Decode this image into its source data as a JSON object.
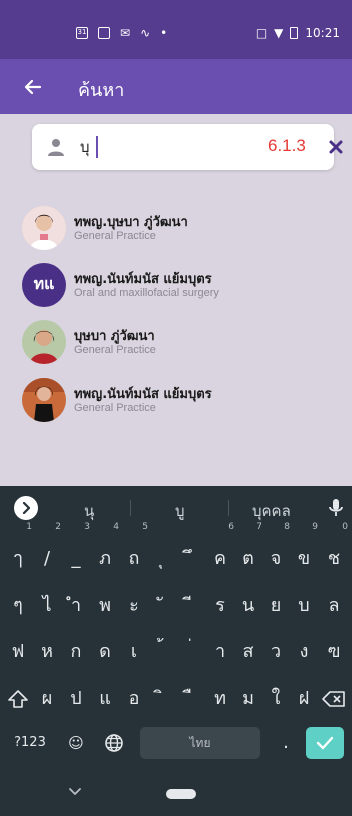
{
  "status_bar": {
    "time": "10:21",
    "icons": [
      "calendar-31-icon",
      "image-icon",
      "gmail-icon",
      "squiggle-icon",
      "dot-icon",
      "vibrate-icon",
      "wifi-icon",
      "battery-icon"
    ],
    "calendar_day": "31"
  },
  "app_bar": {
    "title": "ค้นหา",
    "back_icon": "arrow-left-icon"
  },
  "search": {
    "value": "บุ",
    "version": "6.1.3",
    "clear_icon": "close-icon",
    "person_icon": "person-icon"
  },
  "results": [
    {
      "name": "ทพญ.บุษบา ภู่วัฒนา",
      "specialty": "General Practice",
      "avatar": "photo"
    },
    {
      "name": "ทพญ.นันท์มนัส แย้มบุตร",
      "specialty": "Oral and maxillofacial surgery",
      "avatar": "initials",
      "initials": "ทแ"
    },
    {
      "name": "บุษบา ภู่วัฒนา",
      "specialty": "General Practice",
      "avatar": "photo"
    },
    {
      "name": "ทพญ.นันท์มนัส แย้มบุตร",
      "specialty": "General Practice",
      "avatar": "photo"
    }
  ],
  "keyboard": {
    "suggestions": [
      "นุ",
      "บู",
      "บุคคล"
    ],
    "row1": [
      {
        "k": "ๅ",
        "h": "1"
      },
      {
        "k": "/",
        "h": "2"
      },
      {
        "k": "_",
        "h": "3"
      },
      {
        "k": "ภ",
        "h": "4"
      },
      {
        "k": "ถ",
        "h": "5"
      },
      {
        "k": "ุ",
        "h": ""
      },
      {
        "k": "ึ",
        "h": ""
      },
      {
        "k": "ค",
        "h": "6"
      },
      {
        "k": "ต",
        "h": "7"
      },
      {
        "k": "จ",
        "h": "8"
      },
      {
        "k": "ข",
        "h": "9"
      },
      {
        "k": "ช",
        "h": "0"
      }
    ],
    "row2": [
      "ๆ",
      "ไ",
      "ำ",
      "พ",
      "ะ",
      "ั",
      "ี",
      "ร",
      "น",
      "ย",
      "บ",
      "ล"
    ],
    "row3": [
      "ฟ",
      "ห",
      "ก",
      "ด",
      "เ",
      "้",
      "่",
      "า",
      "ส",
      "ว",
      "ง",
      "ฃ"
    ],
    "row4": [
      "ผ",
      "ป",
      "แ",
      "อ",
      "ิ",
      "ื",
      "ท",
      "ม",
      "ใ",
      "ฝ"
    ],
    "symbols_label": "?123",
    "space_label": "ไทย",
    "period_label": "."
  },
  "colors": {
    "status_bar": "#553c8f",
    "app_bar": "#6a4fb0",
    "background": "#d9d4df",
    "version": "#e53935",
    "keyboard": "#263238",
    "enter": "#5fd0c5"
  }
}
